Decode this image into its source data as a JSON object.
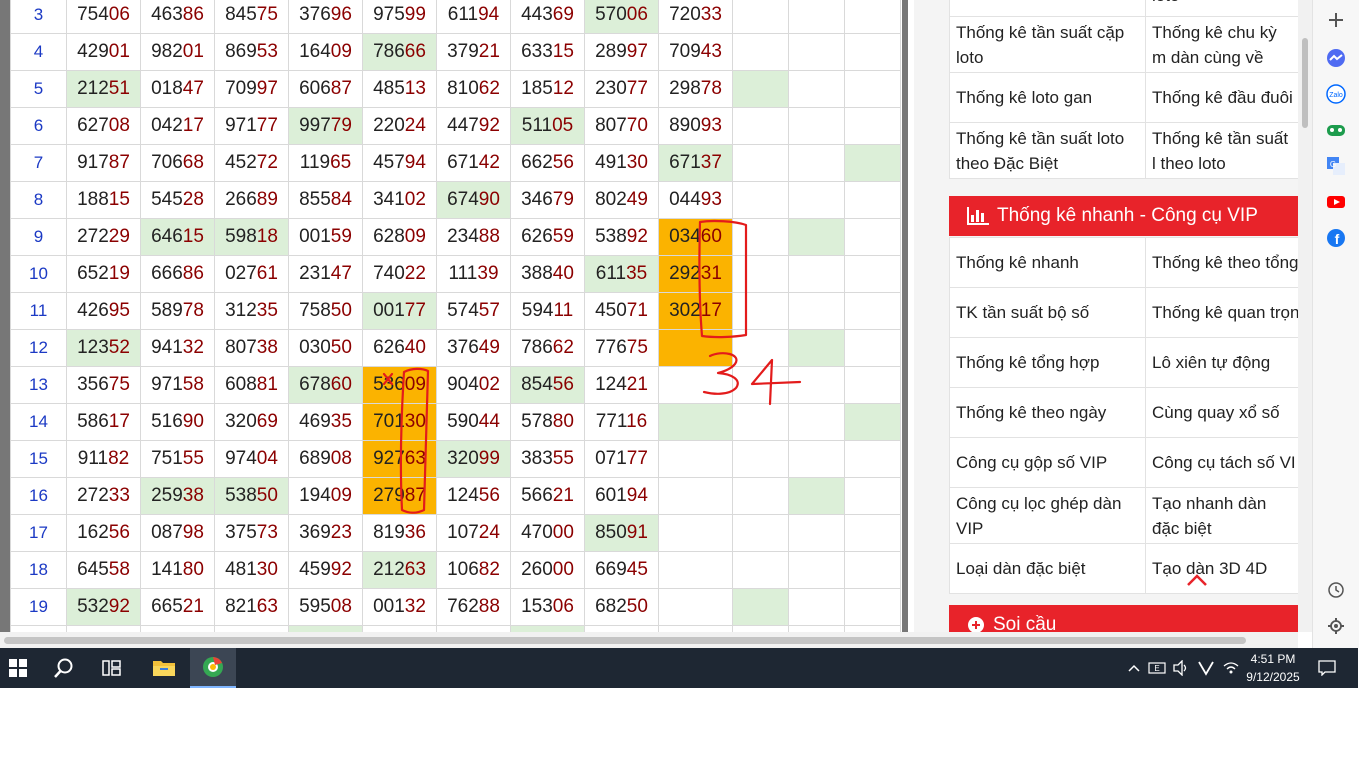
{
  "results_table": {
    "rows": [
      {
        "index": "3",
        "cells": [
          {
            "a": "754",
            "b": "06",
            "hl": ""
          },
          {
            "a": "463",
            "b": "86",
            "hl": ""
          },
          {
            "a": "845",
            "b": "75",
            "hl": ""
          },
          {
            "a": "376",
            "b": "96",
            "hl": ""
          },
          {
            "a": "975",
            "b": "99",
            "hl": ""
          },
          {
            "a": "611",
            "b": "94",
            "hl": ""
          },
          {
            "a": "443",
            "b": "69",
            "hl": ""
          },
          {
            "a": "570",
            "b": "06",
            "hl": "green"
          },
          {
            "a": "720",
            "b": "33",
            "hl": ""
          }
        ],
        "extra": [
          "",
          "",
          ""
        ]
      },
      {
        "index": "4",
        "cells": [
          {
            "a": "429",
            "b": "01",
            "hl": ""
          },
          {
            "a": "982",
            "b": "01",
            "hl": ""
          },
          {
            "a": "869",
            "b": "53",
            "hl": ""
          },
          {
            "a": "164",
            "b": "09",
            "hl": ""
          },
          {
            "a": "786",
            "b": "66",
            "hl": "green"
          },
          {
            "a": "379",
            "b": "21",
            "hl": ""
          },
          {
            "a": "633",
            "b": "15",
            "hl": ""
          },
          {
            "a": "289",
            "b": "97",
            "hl": ""
          },
          {
            "a": "709",
            "b": "43",
            "hl": ""
          }
        ],
        "extra": [
          "",
          "",
          ""
        ]
      },
      {
        "index": "5",
        "cells": [
          {
            "a": "212",
            "b": "51",
            "hl": "green"
          },
          {
            "a": "018",
            "b": "47",
            "hl": ""
          },
          {
            "a": "709",
            "b": "97",
            "hl": ""
          },
          {
            "a": "606",
            "b": "87",
            "hl": ""
          },
          {
            "a": "485",
            "b": "13",
            "hl": ""
          },
          {
            "a": "810",
            "b": "62",
            "hl": ""
          },
          {
            "a": "185",
            "b": "12",
            "hl": ""
          },
          {
            "a": "230",
            "b": "77",
            "hl": ""
          },
          {
            "a": "298",
            "b": "78",
            "hl": ""
          }
        ],
        "extra": [
          "green",
          "",
          ""
        ]
      },
      {
        "index": "6",
        "cells": [
          {
            "a": "627",
            "b": "08",
            "hl": ""
          },
          {
            "a": "042",
            "b": "17",
            "hl": ""
          },
          {
            "a": "971",
            "b": "77",
            "hl": ""
          },
          {
            "a": "997",
            "b": "79",
            "hl": "green"
          },
          {
            "a": "220",
            "b": "24",
            "hl": ""
          },
          {
            "a": "447",
            "b": "92",
            "hl": ""
          },
          {
            "a": "511",
            "b": "05",
            "hl": "green"
          },
          {
            "a": "807",
            "b": "70",
            "hl": ""
          },
          {
            "a": "890",
            "b": "93",
            "hl": ""
          }
        ],
        "extra": [
          "",
          "",
          ""
        ]
      },
      {
        "index": "7",
        "cells": [
          {
            "a": "917",
            "b": "87",
            "hl": ""
          },
          {
            "a": "706",
            "b": "68",
            "hl": ""
          },
          {
            "a": "452",
            "b": "72",
            "hl": ""
          },
          {
            "a": "119",
            "b": "65",
            "hl": ""
          },
          {
            "a": "457",
            "b": "94",
            "hl": ""
          },
          {
            "a": "671",
            "b": "42",
            "hl": ""
          },
          {
            "a": "662",
            "b": "56",
            "hl": ""
          },
          {
            "a": "491",
            "b": "30",
            "hl": ""
          },
          {
            "a": "671",
            "b": "37",
            "hl": "green"
          }
        ],
        "extra": [
          "",
          "",
          "green"
        ]
      },
      {
        "index": "8",
        "cells": [
          {
            "a": "188",
            "b": "15",
            "hl": ""
          },
          {
            "a": "545",
            "b": "28",
            "hl": ""
          },
          {
            "a": "266",
            "b": "89",
            "hl": ""
          },
          {
            "a": "855",
            "b": "84",
            "hl": ""
          },
          {
            "a": "341",
            "b": "02",
            "hl": ""
          },
          {
            "a": "674",
            "b": "90",
            "hl": "green"
          },
          {
            "a": "346",
            "b": "79",
            "hl": ""
          },
          {
            "a": "802",
            "b": "49",
            "hl": ""
          },
          {
            "a": "044",
            "b": "93",
            "hl": ""
          }
        ],
        "extra": [
          "",
          "",
          ""
        ]
      },
      {
        "index": "9",
        "cells": [
          {
            "a": "272",
            "b": "29",
            "hl": ""
          },
          {
            "a": "646",
            "b": "15",
            "hl": "green"
          },
          {
            "a": "598",
            "b": "18",
            "hl": "green"
          },
          {
            "a": "001",
            "b": "59",
            "hl": ""
          },
          {
            "a": "628",
            "b": "09",
            "hl": ""
          },
          {
            "a": "234",
            "b": "88",
            "hl": ""
          },
          {
            "a": "626",
            "b": "59",
            "hl": ""
          },
          {
            "a": "538",
            "b": "92",
            "hl": ""
          },
          {
            "a": "034",
            "b": "60",
            "hl": "orange"
          }
        ],
        "extra": [
          "",
          "green",
          ""
        ]
      },
      {
        "index": "10",
        "cells": [
          {
            "a": "652",
            "b": "19",
            "hl": ""
          },
          {
            "a": "666",
            "b": "86",
            "hl": ""
          },
          {
            "a": "027",
            "b": "61",
            "hl": ""
          },
          {
            "a": "231",
            "b": "47",
            "hl": ""
          },
          {
            "a": "740",
            "b": "22",
            "hl": ""
          },
          {
            "a": "111",
            "b": "39",
            "hl": ""
          },
          {
            "a": "388",
            "b": "40",
            "hl": ""
          },
          {
            "a": "611",
            "b": "35",
            "hl": "green"
          },
          {
            "a": "292",
            "b": "31",
            "hl": "orange"
          }
        ],
        "extra": [
          "",
          "",
          ""
        ]
      },
      {
        "index": "11",
        "cells": [
          {
            "a": "426",
            "b": "95",
            "hl": ""
          },
          {
            "a": "589",
            "b": "78",
            "hl": ""
          },
          {
            "a": "312",
            "b": "35",
            "hl": ""
          },
          {
            "a": "758",
            "b": "50",
            "hl": ""
          },
          {
            "a": "001",
            "b": "77",
            "hl": "green"
          },
          {
            "a": "574",
            "b": "57",
            "hl": ""
          },
          {
            "a": "594",
            "b": "11",
            "hl": ""
          },
          {
            "a": "450",
            "b": "71",
            "hl": ""
          },
          {
            "a": "302",
            "b": "17",
            "hl": "orange"
          }
        ],
        "extra": [
          "",
          "",
          ""
        ]
      },
      {
        "index": "12",
        "cells": [
          {
            "a": "123",
            "b": "52",
            "hl": "green"
          },
          {
            "a": "941",
            "b": "32",
            "hl": ""
          },
          {
            "a": "807",
            "b": "38",
            "hl": ""
          },
          {
            "a": "030",
            "b": "50",
            "hl": ""
          },
          {
            "a": "626",
            "b": "40",
            "hl": ""
          },
          {
            "a": "376",
            "b": "49",
            "hl": ""
          },
          {
            "a": "786",
            "b": "62",
            "hl": ""
          },
          {
            "a": "776",
            "b": "75",
            "hl": ""
          },
          {
            "a": "",
            "b": "",
            "hl": "orange"
          }
        ],
        "extra": [
          "",
          "green",
          ""
        ]
      },
      {
        "index": "13",
        "cells": [
          {
            "a": "356",
            "b": "75",
            "hl": ""
          },
          {
            "a": "971",
            "b": "58",
            "hl": ""
          },
          {
            "a": "608",
            "b": "81",
            "hl": ""
          },
          {
            "a": "678",
            "b": "60",
            "hl": "green"
          },
          {
            "a": "536",
            "b": "09",
            "hl": "orange"
          },
          {
            "a": "904",
            "b": "02",
            "hl": ""
          },
          {
            "a": "854",
            "b": "56",
            "hl": "green"
          },
          {
            "a": "124",
            "b": "21",
            "hl": ""
          },
          {
            "a": "",
            "b": "",
            "hl": ""
          }
        ],
        "extra": [
          "",
          "",
          ""
        ]
      },
      {
        "index": "14",
        "cells": [
          {
            "a": "586",
            "b": "17",
            "hl": ""
          },
          {
            "a": "516",
            "b": "90",
            "hl": ""
          },
          {
            "a": "320",
            "b": "69",
            "hl": ""
          },
          {
            "a": "469",
            "b": "35",
            "hl": ""
          },
          {
            "a": "701",
            "b": "30",
            "hl": "orange"
          },
          {
            "a": "590",
            "b": "44",
            "hl": ""
          },
          {
            "a": "578",
            "b": "80",
            "hl": ""
          },
          {
            "a": "771",
            "b": "16",
            "hl": ""
          },
          {
            "a": "",
            "b": "",
            "hl": "green"
          }
        ],
        "extra": [
          "",
          "",
          "green"
        ]
      },
      {
        "index": "15",
        "cells": [
          {
            "a": "911",
            "b": "82",
            "hl": ""
          },
          {
            "a": "751",
            "b": "55",
            "hl": ""
          },
          {
            "a": "974",
            "b": "04",
            "hl": ""
          },
          {
            "a": "689",
            "b": "08",
            "hl": ""
          },
          {
            "a": "927",
            "b": "63",
            "hl": "orange"
          },
          {
            "a": "320",
            "b": "99",
            "hl": "green"
          },
          {
            "a": "383",
            "b": "55",
            "hl": ""
          },
          {
            "a": "071",
            "b": "77",
            "hl": ""
          },
          {
            "a": "",
            "b": "",
            "hl": ""
          }
        ],
        "extra": [
          "",
          "",
          ""
        ]
      },
      {
        "index": "16",
        "cells": [
          {
            "a": "272",
            "b": "33",
            "hl": ""
          },
          {
            "a": "259",
            "b": "38",
            "hl": "green"
          },
          {
            "a": "538",
            "b": "50",
            "hl": "green"
          },
          {
            "a": "194",
            "b": "09",
            "hl": ""
          },
          {
            "a": "279",
            "b": "87",
            "hl": "orange"
          },
          {
            "a": "124",
            "b": "56",
            "hl": ""
          },
          {
            "a": "566",
            "b": "21",
            "hl": ""
          },
          {
            "a": "601",
            "b": "94",
            "hl": ""
          },
          {
            "a": "",
            "b": "",
            "hl": ""
          }
        ],
        "extra": [
          "",
          "green",
          ""
        ]
      },
      {
        "index": "17",
        "cells": [
          {
            "a": "162",
            "b": "56",
            "hl": ""
          },
          {
            "a": "087",
            "b": "98",
            "hl": ""
          },
          {
            "a": "375",
            "b": "73",
            "hl": ""
          },
          {
            "a": "369",
            "b": "23",
            "hl": ""
          },
          {
            "a": "819",
            "b": "36",
            "hl": ""
          },
          {
            "a": "107",
            "b": "24",
            "hl": ""
          },
          {
            "a": "470",
            "b": "00",
            "hl": ""
          },
          {
            "a": "850",
            "b": "91",
            "hl": "green"
          },
          {
            "a": "",
            "b": "",
            "hl": ""
          }
        ],
        "extra": [
          "",
          "",
          ""
        ]
      },
      {
        "index": "18",
        "cells": [
          {
            "a": "645",
            "b": "58",
            "hl": ""
          },
          {
            "a": "141",
            "b": "80",
            "hl": ""
          },
          {
            "a": "481",
            "b": "30",
            "hl": ""
          },
          {
            "a": "459",
            "b": "92",
            "hl": ""
          },
          {
            "a": "212",
            "b": "63",
            "hl": "green"
          },
          {
            "a": "106",
            "b": "82",
            "hl": ""
          },
          {
            "a": "260",
            "b": "00",
            "hl": ""
          },
          {
            "a": "669",
            "b": "45",
            "hl": ""
          },
          {
            "a": "",
            "b": "",
            "hl": ""
          }
        ],
        "extra": [
          "",
          "",
          ""
        ]
      },
      {
        "index": "19",
        "cells": [
          {
            "a": "532",
            "b": "92",
            "hl": "green"
          },
          {
            "a": "665",
            "b": "21",
            "hl": ""
          },
          {
            "a": "821",
            "b": "63",
            "hl": ""
          },
          {
            "a": "595",
            "b": "08",
            "hl": ""
          },
          {
            "a": "001",
            "b": "32",
            "hl": ""
          },
          {
            "a": "762",
            "b": "88",
            "hl": ""
          },
          {
            "a": "153",
            "b": "06",
            "hl": ""
          },
          {
            "a": "682",
            "b": "50",
            "hl": ""
          },
          {
            "a": "",
            "b": "",
            "hl": ""
          }
        ],
        "extra": [
          "green",
          "",
          ""
        ]
      },
      {
        "index": "",
        "cells": [
          {
            "a": "",
            "b": "",
            "hl": ""
          },
          {
            "a": "",
            "b": "",
            "hl": ""
          },
          {
            "a": "",
            "b": "",
            "hl": ""
          },
          {
            "a": "",
            "b": "",
            "hl": "green"
          },
          {
            "a": "",
            "b": "",
            "hl": ""
          },
          {
            "a": "",
            "b": "",
            "hl": ""
          },
          {
            "a": "",
            "b": "",
            "hl": "green"
          },
          {
            "a": "",
            "b": "",
            "hl": ""
          },
          {
            "a": "",
            "b": "",
            "hl": ""
          }
        ],
        "extra": [
          "",
          "",
          ""
        ]
      }
    ]
  },
  "annotation": {
    "handwritten_number": "34",
    "cross_mark": "x",
    "color": "#e31b1b"
  },
  "sidebar": {
    "stats_top": {
      "partial_top": "loto",
      "rows": [
        [
          "Thống kê tần suất cặp loto",
          "Thống kê chu kỳ m dàn cùng về"
        ],
        [
          "Thống kê loto gan",
          "Thống kê đầu đuôi"
        ],
        [
          "Thống kê tần suất loto theo Đặc Biệt",
          "Thống kê tần suất l theo loto"
        ]
      ]
    },
    "quick_stats": {
      "title": "Thống kê nhanh - Công cụ VIP",
      "rows": [
        [
          "Thống kê nhanh",
          "Thống kê theo tổng"
        ],
        [
          "TK tần suất bộ số",
          "Thống kê quan trọn"
        ],
        [
          "Thống kê tổng hợp",
          "Lô xiên tự động"
        ],
        [
          "Thống kê theo ngày",
          "Cùng quay xổ số"
        ],
        [
          "Công cụ gộp số VIP",
          "Công cụ tách số VI"
        ],
        [
          "Công cụ lọc ghép dàn VIP",
          "Tạo nhanh dàn đặc biệt"
        ],
        [
          "Loại dàn đặc biệt",
          "Tạo dàn 3D 4D"
        ]
      ]
    },
    "soi_cau": {
      "title": "Soi cầu"
    }
  },
  "edge_sidebar": {
    "icons": [
      "add-icon",
      "messenger-icon",
      "zalo-icon",
      "games-icon",
      "translate-icon",
      "youtube-icon",
      "facebook-icon",
      "history-icon",
      "settings-icon"
    ]
  },
  "taskbar": {
    "apps": [
      "start-icon",
      "search-icon",
      "task-view-icon",
      "file-explorer-icon",
      "browser-app-icon"
    ],
    "tray": {
      "time": "4:51 PM",
      "date": "9/12/2025"
    }
  },
  "colors": {
    "green_highlight": "#dcefd8",
    "orange_highlight": "#fbb300",
    "red_header": "#e8232a",
    "index_blue": "#1b39c4",
    "last_digits": "#8b0000"
  }
}
